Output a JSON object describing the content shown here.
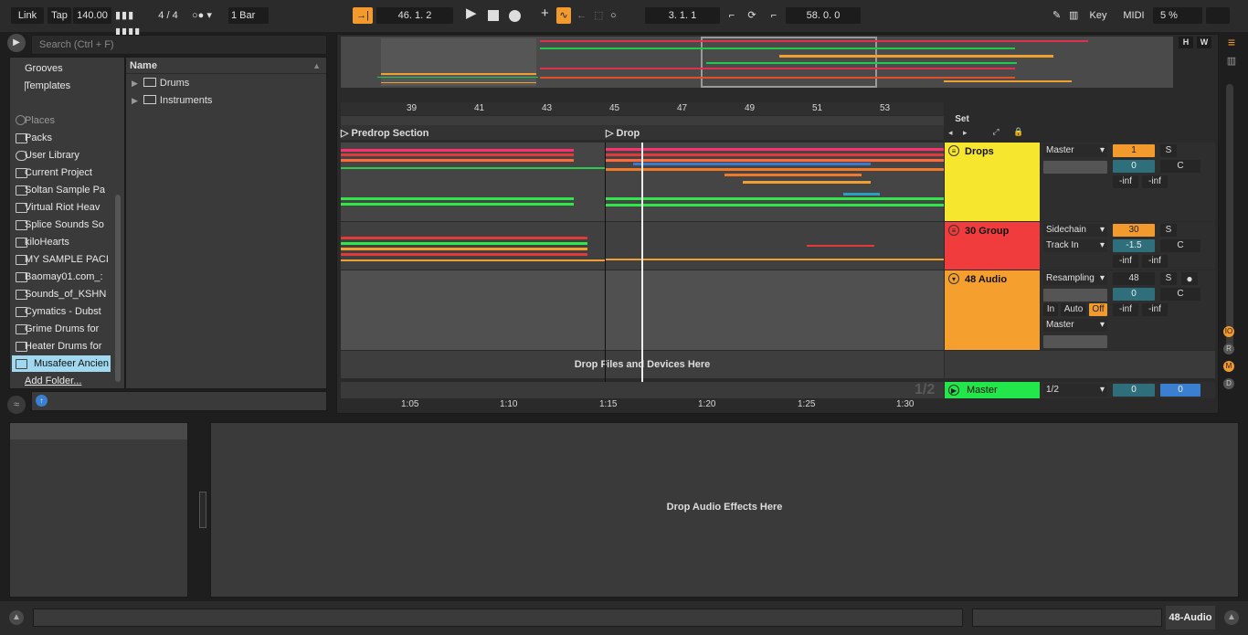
{
  "topbar": {
    "link": "Link",
    "tap": "Tap",
    "tempo": "140.00",
    "time_signature": "4 / 4",
    "quantize": "1 Bar",
    "position": "46.  1.  2",
    "loop_start": "3.  1.  1",
    "loop_length": "58.  0.  0",
    "key": "Key",
    "midi": "MIDI",
    "cpu": "5 %"
  },
  "browser": {
    "search_placeholder": "Search (Ctrl + F)",
    "items": [
      {
        "label": "Grooves",
        "icon": "grooves-icon"
      },
      {
        "label": "Templates",
        "icon": "templates-icon"
      }
    ],
    "places_header": "Places",
    "places": [
      {
        "label": "Packs",
        "icon": "packs-icon"
      },
      {
        "label": "User Library",
        "icon": "user-icon"
      },
      {
        "label": "Current Project",
        "icon": "project-icon"
      },
      {
        "label": "Soltan Sample Pa",
        "icon": "folder-icon"
      },
      {
        "label": "Virtual Riot Heav",
        "icon": "folder-icon"
      },
      {
        "label": "Splice Sounds So",
        "icon": "folder-icon"
      },
      {
        "label": "kiloHearts",
        "icon": "folder-icon"
      },
      {
        "label": "MY SAMPLE PACI",
        "icon": "folder-icon"
      },
      {
        "label": "Baomay01.com_:",
        "icon": "folder-icon"
      },
      {
        "label": "Sounds_of_KSHN",
        "icon": "folder-icon"
      },
      {
        "label": "Cymatics - Dubst",
        "icon": "folder-icon"
      },
      {
        "label": "Grime Drums for",
        "icon": "folder-icon"
      },
      {
        "label": "Heater Drums for",
        "icon": "folder-icon"
      },
      {
        "label": "Musafeer Ancien",
        "icon": "folder-icon",
        "selected": true
      }
    ],
    "add_folder": "Add Folder...",
    "name_header": "Name",
    "files": [
      {
        "label": "Drums"
      },
      {
        "label": "Instruments"
      }
    ]
  },
  "arrangement": {
    "bar_numbers": [
      "39",
      "41",
      "43",
      "45",
      "47",
      "49",
      "51",
      "53"
    ],
    "locators": [
      "Predrop Section",
      "Drop"
    ],
    "drop_files_text": "Drop Files and Devices Here",
    "time_labels": [
      "1:05",
      "1:10",
      "1:15",
      "1:20",
      "1:25",
      "1:30"
    ],
    "zoom_ratio": "1/2",
    "set_label": "Set",
    "h_button": "H",
    "w_button": "W"
  },
  "tracks": [
    {
      "name": "Drops",
      "color": "#f6e62e",
      "output": "Master",
      "number": "1",
      "solo": "S",
      "pan": "0",
      "pan_c": "C",
      "vol_l": "-inf",
      "vol_r": "-inf"
    },
    {
      "name": "30 Group",
      "color": "#f03c3c",
      "input": "Sidechain",
      "input2": "Track In",
      "number": "30",
      "solo": "S",
      "pan": "-1.5",
      "pan_c": "C",
      "vol_l": "-inf",
      "vol_r": "-inf"
    },
    {
      "name": "48 Audio",
      "color": "#f5a02e",
      "input": "Resampling",
      "monitor_in": "In",
      "monitor_auto": "Auto",
      "monitor_off": "Off",
      "output": "Master",
      "number": "48",
      "solo": "S",
      "pan": "0",
      "pan_c": "C",
      "vol_l": "-inf",
      "vol_r": "-inf"
    }
  ],
  "master": {
    "name": "Master",
    "color": "#22e64a",
    "route": "1/2",
    "val1": "0",
    "val2": "0"
  },
  "side_buttons": [
    "IO",
    "R",
    "M",
    "D"
  ],
  "detail": {
    "drop_effects": "Drop Audio Effects Here"
  },
  "statusbar": {
    "track_name": "48-Audio"
  }
}
